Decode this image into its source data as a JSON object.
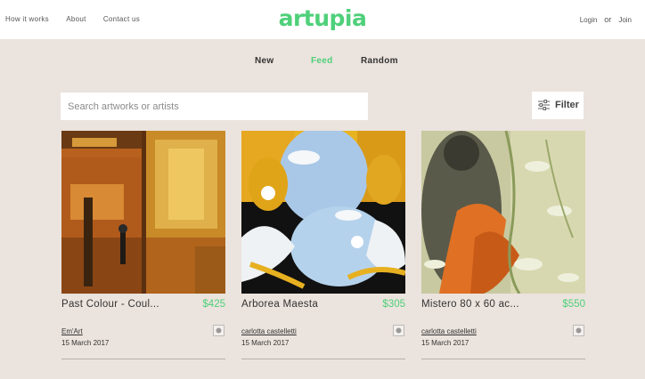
{
  "header": {
    "nav_left": [
      "How it works",
      "About",
      "Contact us"
    ],
    "logo": "artupia",
    "login": "Login",
    "or": "or",
    "join": "Join"
  },
  "tabs": [
    {
      "label": "New",
      "active": false
    },
    {
      "label": "Feed",
      "active": true
    },
    {
      "label": "Random",
      "active": false
    }
  ],
  "search": {
    "placeholder": "Search artworks or artists"
  },
  "filter": {
    "label": "Filter"
  },
  "colors": {
    "accent": "#4fd07a",
    "background": "#ebe3dd"
  },
  "artworks": [
    {
      "title": "Past Colour - Coul...",
      "price": "$425",
      "artist": "Em'Art",
      "date": "15 March 2017"
    },
    {
      "title": "Arborea Maesta",
      "price": "$305",
      "artist": "carlotta castelletti",
      "date": "15 March 2017"
    },
    {
      "title": "Mistero 80 x 60 ac...",
      "price": "$550",
      "artist": "carlotta castelletti",
      "date": "15 March 2017"
    }
  ]
}
